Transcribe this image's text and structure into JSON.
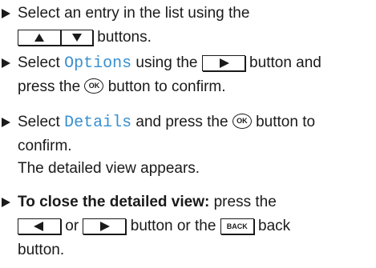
{
  "steps": [
    {
      "line1": "Select an entry in the list using the",
      "line2_end": "buttons."
    },
    {
      "line1_a": "Select ",
      "term": "Options",
      "line1_b": " using the ",
      "line1_c": " button and",
      "line2_a": "press the ",
      "line2_b": " button to confirm."
    },
    {
      "line1_a": "Select ",
      "term": "Details",
      "line1_b": " and press the ",
      "line1_c": " button to",
      "line2": "confirm.",
      "result": "The detailed view appears."
    },
    {
      "heading": "To close the detailed view:",
      "line1_rest": " press the",
      "line2_or": "or",
      "line2_mid": "button or the",
      "line2_end": "back",
      "line3": "button."
    }
  ],
  "icons": {
    "ok_label": "OK",
    "back_label": "BACK"
  }
}
